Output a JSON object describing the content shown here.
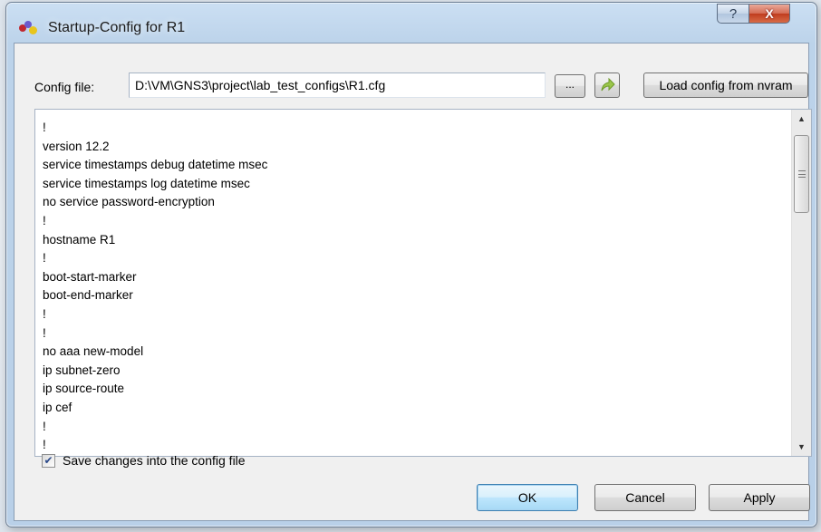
{
  "window": {
    "title": "Startup-Config for R1",
    "help_glyph": "?",
    "close_glyph": "X"
  },
  "config_file": {
    "label": "Config file:",
    "value": "D:\\VM\\GNS3\\project\\lab_test_configs\\R1.cfg",
    "browse_label": "...",
    "load_label": "Load config from nvram"
  },
  "editor": {
    "lines": [
      "!",
      "version 12.2",
      "service timestamps debug datetime msec",
      "service timestamps log datetime msec",
      "no service password-encryption",
      "!",
      "hostname R1",
      "!",
      "boot-start-marker",
      "boot-end-marker",
      "!",
      "!",
      "no aaa new-model",
      "ip subnet-zero",
      "ip source-route",
      "ip cef",
      "!",
      "!"
    ]
  },
  "save_option": {
    "label": "Save changes into the config file",
    "checked": true
  },
  "buttons": {
    "ok": "OK",
    "cancel": "Cancel",
    "apply": "Apply"
  },
  "colors": {
    "close_button": "#c03c1e",
    "default_button_border": "#3c7fb1",
    "window_frame": "#b9d0e8"
  },
  "icons": {
    "app": "gns3-dots-icon",
    "open": "open-arrow-icon",
    "check": "checkmark-icon"
  }
}
